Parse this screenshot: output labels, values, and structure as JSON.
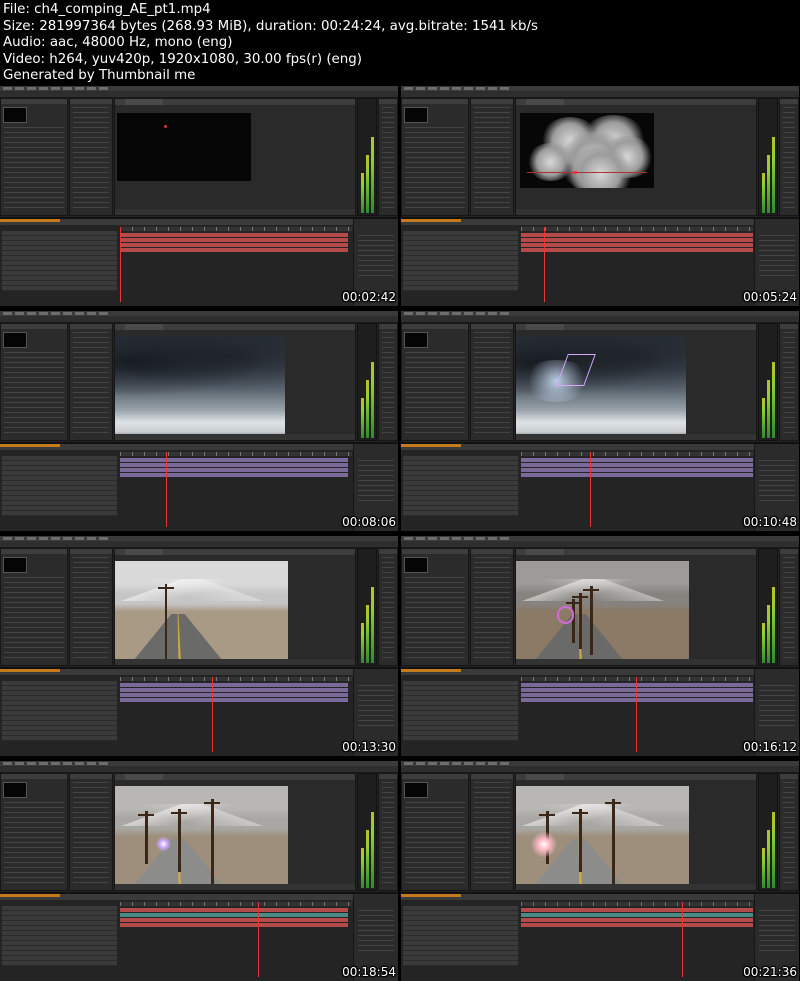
{
  "info": {
    "file": "File: ch4_comping_AE_pt1.mp4",
    "size": "Size: 281997364 bytes (268.93 MiB), duration: 00:24:24, avg.bitrate: 1541 kb/s",
    "audio": "Audio: aac, 48000 Hz, mono (eng)",
    "video": "Video: h264, yuv420p, 1920x1080, 30.00 fps(r) (eng)",
    "generator": "Generated by Thumbnail me"
  },
  "thumbnails": [
    {
      "timestamp": "00:02:42",
      "scene": "black-solid"
    },
    {
      "timestamp": "00:05:24",
      "scene": "smoke"
    },
    {
      "timestamp": "00:08:06",
      "scene": "storm-clouds"
    },
    {
      "timestamp": "00:10:48",
      "scene": "storm-clouds-lightning"
    },
    {
      "timestamp": "00:13:30",
      "scene": "road-pole"
    },
    {
      "timestamp": "00:16:12",
      "scene": "road-pole-arc"
    },
    {
      "timestamp": "00:18:54",
      "scene": "foggy-road-arc"
    },
    {
      "timestamp": "00:21:36",
      "scene": "foggy-road-spark"
    }
  ],
  "colors": {
    "header_bg": "#000000",
    "header_text": "#ffffff",
    "ui_panel": "#2b2b2b",
    "timeline_bar_red": "#b44a4a",
    "timeline_bar_purple": "#7a6a9a",
    "timeline_bar_teal": "#4a8a84",
    "playhead": "#ee3333"
  }
}
